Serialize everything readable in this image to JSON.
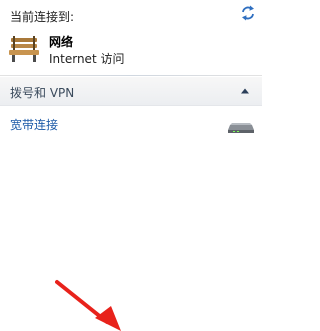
{
  "header": {
    "connected_label": "当前连接到:",
    "refresh_icon": "refresh-arrows-icon"
  },
  "network": {
    "name": "网络",
    "access": "Internet 访问",
    "icon": "park-bench-icon"
  },
  "section": {
    "title": "拨号和 VPN",
    "collapse_icon": "chevron-up-icon"
  },
  "vpn_items": [
    {
      "label": "宽带连接",
      "icon": "modem-icon"
    }
  ],
  "annotation": {
    "arrow_color": "#e8221b"
  }
}
